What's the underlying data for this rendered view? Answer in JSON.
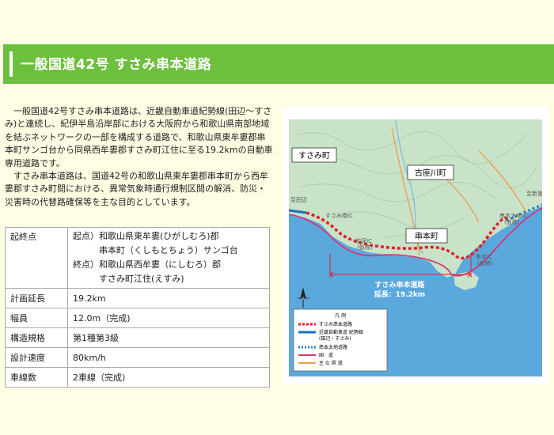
{
  "page_title": "一般国道42号 すさみ串本道路",
  "intro_paragraphs": [
    "一般国道42号すさみ串本道路は、近畿自動車道紀勢線(田辺～すさみ)と連続し、紀伊半島沿岸部における大阪府から和歌山県南部地域を結ぶネットワークの一部を構成する道路で、和歌山県東牟婁郡串本町サンゴ台から同県西牟婁郡すさみ町江住に至る19.2kmの自動車専用道路です。",
    "すさみ串本道路は、国道42号の和歌山県東牟婁郡串本町から西牟婁郡すさみ町間における、異常気象時通行規制区間の解消、防災・災害時の代替路確保等を主な目的としています。"
  ],
  "spec_table": {
    "origin_label": "起終点",
    "origin_lines": [
      "起点）和歌山県東牟婁(ひがしむろ)郡",
      "　　　串本町（くしもとちょう）サンゴ台",
      "終点）和歌山県西牟婁（にしむろ）郡",
      "　　　すさみ町江住(えすみ)"
    ],
    "rows": [
      {
        "label": "計画延長",
        "value": "19.2km"
      },
      {
        "label": "幅員",
        "value": "12.0m（完成)"
      },
      {
        "label": "構造規格",
        "value": "第1種第3級"
      },
      {
        "label": "設計速度",
        "value": "80km/h"
      },
      {
        "label": "車線数",
        "value": "2車線（完成)"
      }
    ]
  },
  "map": {
    "town_susami": "すさみ町",
    "town_kozagawa": "古座川町",
    "town_kushimoto": "串本町",
    "label_susami_south_ic": "すさみ南IC",
    "label_wafuka_ic": "和深IC",
    "label_wafuka_ic_tentative": "(仮称)",
    "label_kushimoto_ic": "串本IC",
    "label_kushimoto_ic_tentative": "(仮称)",
    "label_kushimoto_taichi_ic": "串本太地IC",
    "label_kushimoto_taichi_tentative": "(仮称)",
    "label_left_edge": "至田辺",
    "label_right_edge": "至新宮",
    "route_name": "すさみ串本道路",
    "route_length": "延長：19.2km",
    "legend_title": "凡 例",
    "legend_items": [
      "すさみ串本道路",
      "近畿自動車道 紀勢線",
      "(田辺・すさみ)",
      "串本太地道路",
      "国　道",
      "主 な 県 道"
    ],
    "colors": {
      "sea": "#5aa8dc",
      "land": "#c8e3c8",
      "route_red": "#e0202a",
      "kisei_blue": "#1a6fc0",
      "taichi_blue": "#2b7fd1",
      "national_road": "#d0397a",
      "prefectural_road": "#f0a050"
    }
  }
}
